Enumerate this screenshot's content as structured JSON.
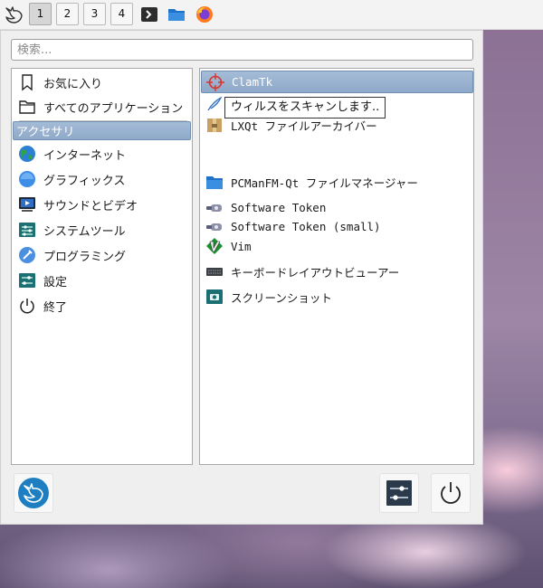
{
  "panel": {
    "workspaces": [
      "1",
      "2",
      "3",
      "4"
    ],
    "active_workspace": "1",
    "tasks": [
      "terminal-icon",
      "folder-icon",
      "firefox-icon"
    ]
  },
  "menu": {
    "search": {
      "placeholder": "検索...",
      "value": ""
    },
    "categories": [
      {
        "label": "お気に入り",
        "icon": "bookmark-icon"
      },
      {
        "label": "すべてのアプリケーション",
        "icon": "folder-icon"
      },
      {
        "label": "アクセサリ",
        "icon": "accessories-icon",
        "selected": true
      },
      {
        "label": "インターネット",
        "icon": "globe-icon"
      },
      {
        "label": "グラフィックス",
        "icon": "graphics-icon"
      },
      {
        "label": "サウンドとビデオ",
        "icon": "multimedia-icon"
      },
      {
        "label": "システムツール",
        "icon": "system-tools-icon"
      },
      {
        "label": "プログラミング",
        "icon": "programming-icon"
      },
      {
        "label": "設定",
        "icon": "settings-icon"
      },
      {
        "label": "終了",
        "icon": "power-icon"
      }
    ],
    "apps": [
      {
        "label": "ClamTk",
        "icon": "clamtk-icon",
        "selected": true
      },
      {
        "label": "",
        "icon": "feather-icon"
      },
      {
        "label": "LXQt ファイルアーカイバー",
        "icon": "archive-icon"
      },
      {
        "label": "PCManFM-Qt ファイルマネージャー",
        "icon": "folder-icon"
      },
      {
        "label": "Software Token",
        "icon": "token-icon"
      },
      {
        "label": "Software Token (small)",
        "icon": "token-icon"
      },
      {
        "label": "Vim",
        "icon": "vim-icon"
      },
      {
        "label": "キーボードレイアウトビューアー",
        "icon": "keyboard-icon"
      },
      {
        "label": "スクリーンショット",
        "icon": "screenshot-icon"
      }
    ],
    "tooltip": "ウィルスをスキャンします..",
    "bottom_buttons": [
      "lxqt-logo-icon",
      "settings-sliders-icon",
      "power-icon"
    ]
  },
  "colors": {
    "selection": "#8ea9c9",
    "panel": "#f3f3f3"
  }
}
